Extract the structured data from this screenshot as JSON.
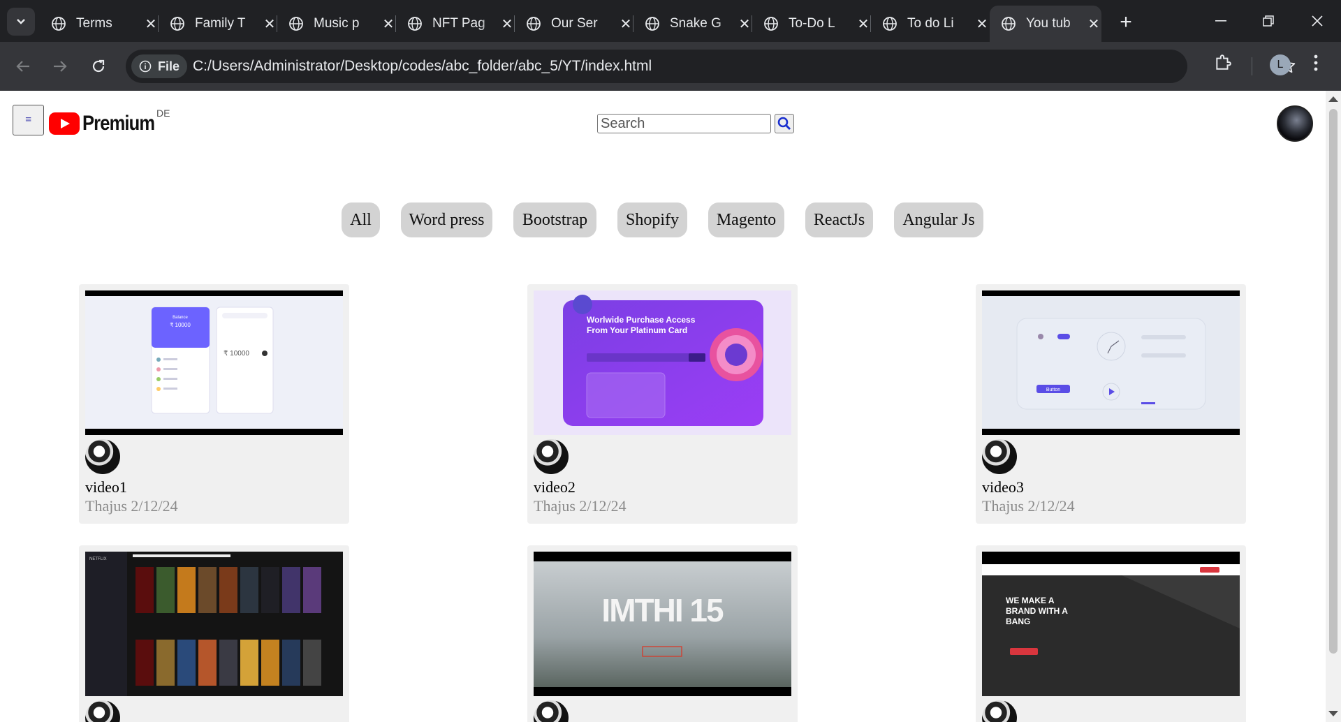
{
  "browser": {
    "tabs": [
      {
        "title": "Terms",
        "active": false
      },
      {
        "title": "Family T",
        "active": false
      },
      {
        "title": "Music p",
        "active": false
      },
      {
        "title": "NFT Pag",
        "active": false
      },
      {
        "title": "Our Ser",
        "active": false
      },
      {
        "title": "Snake G",
        "active": false
      },
      {
        "title": "To-Do L",
        "active": false
      },
      {
        "title": "To do Li",
        "active": false
      },
      {
        "title": "You tub",
        "active": true
      }
    ],
    "chip_label": "File",
    "url": "C:/Users/Administrator/Desktop/codes/abc_folder/abc_5/YT/index.html",
    "profile_initial": "L"
  },
  "header": {
    "logo_text": "Premium",
    "region": "DE",
    "search_placeholder": "Search",
    "menu_glyph": "≡"
  },
  "filters": [
    "All",
    "Word press",
    "Bootstrap",
    "Shopify",
    "Magento",
    "ReactJs",
    "Angular Js"
  ],
  "videos": [
    {
      "title": "video1",
      "meta": "Thajus 2/12/24"
    },
    {
      "title": "video2",
      "meta": "Thajus 2/12/24"
    },
    {
      "title": "video3",
      "meta": "Thajus 2/12/24"
    },
    {
      "title": "",
      "meta": ""
    },
    {
      "title": "",
      "meta": ""
    },
    {
      "title": "",
      "meta": ""
    }
  ],
  "thumbnails": {
    "t1": {
      "balance_label": "Balance",
      "balance": "₹ 10000",
      "entry": "₹ 10000"
    },
    "t2": {
      "headline1": "Worlwide Purchase Access",
      "headline2": "From Your Platinum Card"
    },
    "t3": {
      "button": "Button"
    },
    "t4": {
      "brand": "NETFLIX"
    },
    "t5": {
      "title": "IMTHI 15"
    },
    "t6": {
      "line1": "WE MAKE A",
      "line2": "BRAND WITH A",
      "line3": "BANG"
    }
  },
  "colors": {
    "brand": "#ff0000",
    "chip_bg": "#d3d3d3",
    "card_bg": "#f0f0f0"
  }
}
